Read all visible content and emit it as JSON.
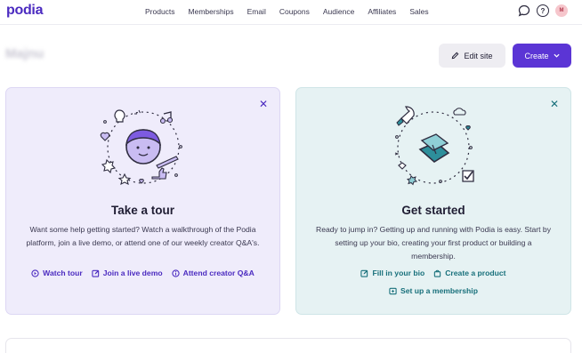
{
  "nav": {
    "logo": "podia",
    "links": [
      "Products",
      "Memberships",
      "Email",
      "Coupons",
      "Audience",
      "Affiliates",
      "Sales"
    ],
    "avatar_initial": "M"
  },
  "header": {
    "site_name": "Majnu",
    "edit_site_label": "Edit site",
    "create_label": "Create"
  },
  "tour_card": {
    "title": "Take a tour",
    "body": "Want some help getting started? Watch a walkthrough of the Podia platform, join a live demo, or attend one of our weekly creator Q&A's.",
    "links": [
      "Watch tour",
      "Join a live demo",
      "Attend creator Q&A"
    ]
  },
  "start_card": {
    "title": "Get started",
    "body": "Ready to jump in? Getting up and running with Podia is easy. Start by setting up your bio, creating your first product or building a membership.",
    "links": [
      "Fill in your bio",
      "Create a product",
      "Set up a membership"
    ]
  },
  "colors": {
    "brand": "#4b2bc0",
    "create_button": "#5b35d5",
    "tour_bg": "#efecfb",
    "start_bg": "#e6f2f3",
    "teal_link": "#18707b"
  }
}
